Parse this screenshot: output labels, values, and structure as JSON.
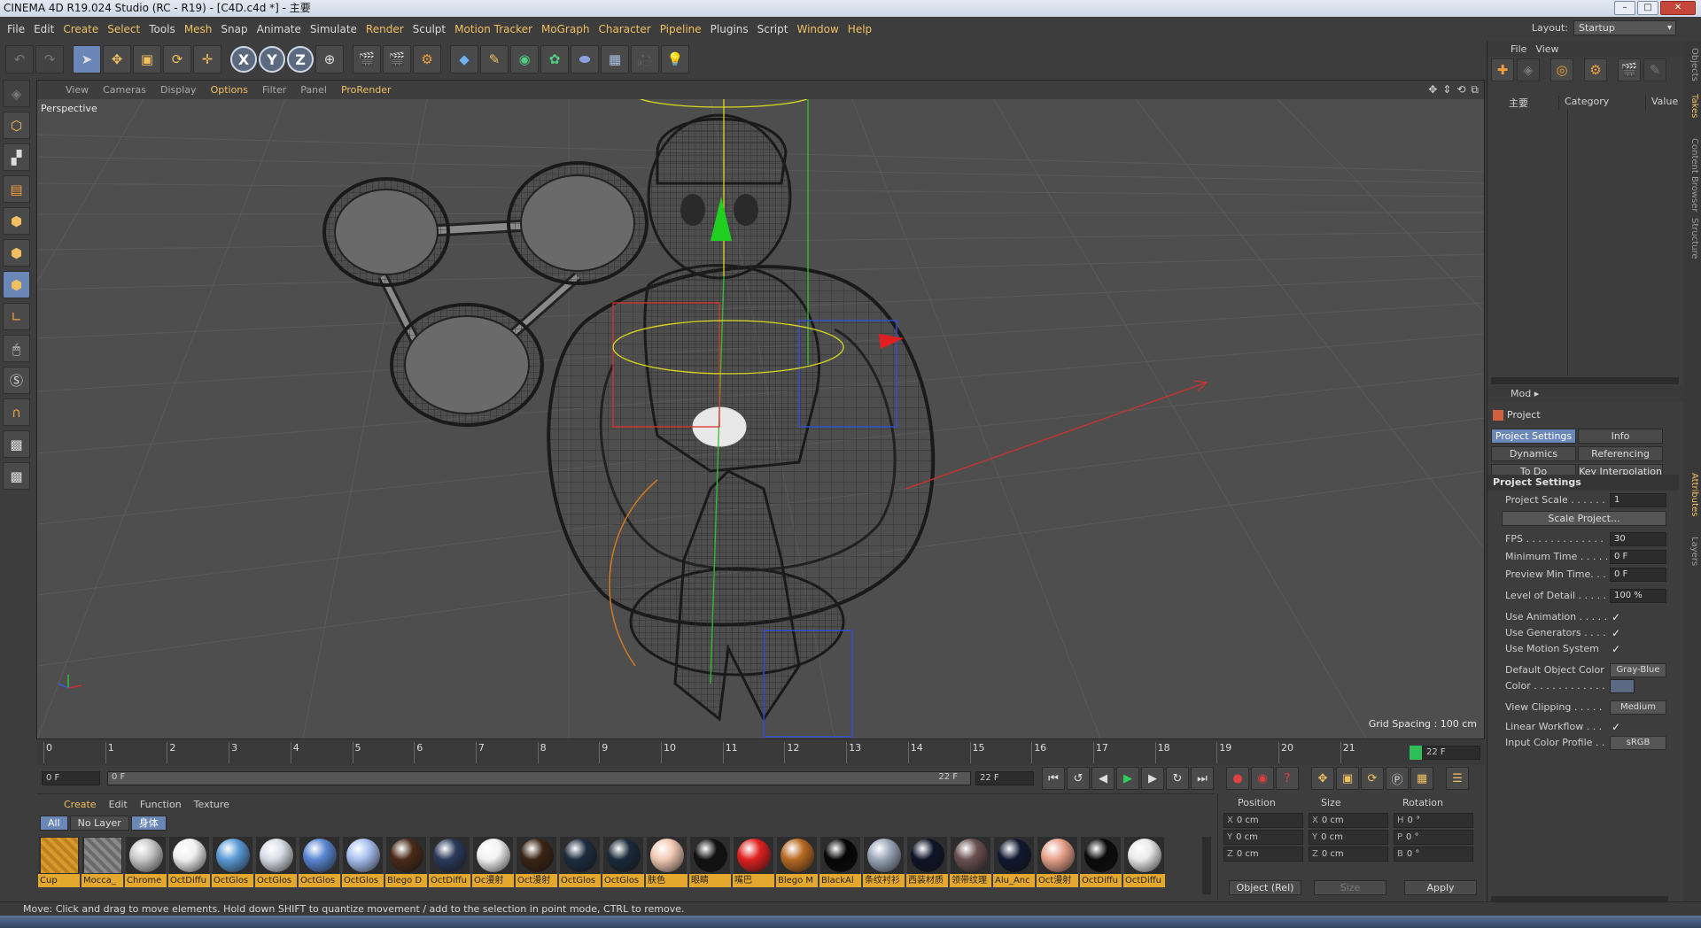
{
  "window": {
    "title": "CINEMA 4D R19.024 Studio (RC - R19) - [C4D.c4d *] - 主要"
  },
  "menu": [
    "File",
    "Edit",
    "Create",
    "Select",
    "Tools",
    "Mesh",
    "Snap",
    "Animate",
    "Simulate",
    "Render",
    "Sculpt",
    "Motion Tracker",
    "MoGraph",
    "Character",
    "Pipeline",
    "Plugins",
    "Script",
    "Window",
    "Help"
  ],
  "layout": {
    "label": "Layout:",
    "value": "Startup"
  },
  "viewport": {
    "menu": [
      "View",
      "Cameras",
      "Display",
      "Options",
      "Filter",
      "Panel",
      "ProRender"
    ],
    "camera": "Perspective",
    "grid_spacing": "Grid Spacing : 100 cm"
  },
  "timeline": {
    "ticks": [
      "0",
      "1",
      "2",
      "3",
      "4",
      "5",
      "6",
      "7",
      "8",
      "9",
      "10",
      "11",
      "12",
      "13",
      "14",
      "15",
      "16",
      "17",
      "18",
      "19",
      "20",
      "21"
    ],
    "current": "22 F",
    "start": "0 F",
    "range_start": "0 F",
    "range_end": "22 F",
    "end": "22 F"
  },
  "materials": {
    "menu": [
      "Create",
      "Edit",
      "Function",
      "Texture"
    ],
    "filters": [
      "All",
      "No Layer",
      "身体"
    ],
    "items": [
      {
        "name": "Cup",
        "color": "#e5a82e"
      },
      {
        "name": "Mocca_",
        "color": "#8a8a8a"
      },
      {
        "name": "Chrome",
        "color": "#c8c8c8"
      },
      {
        "name": "OctDiffu",
        "color": "#f0f0f0"
      },
      {
        "name": "OctGlos",
        "color": "#5b9ad6"
      },
      {
        "name": "OctGlos",
        "color": "#d8dde6"
      },
      {
        "name": "OctGlos",
        "color": "#5a86d2"
      },
      {
        "name": "OctGlos",
        "color": "#a8c0f0"
      },
      {
        "name": "Blego D",
        "color": "#4a2a18"
      },
      {
        "name": "OctDiffu",
        "color": "#2a3a5a"
      },
      {
        "name": "Oc漫射",
        "color": "#f2f2f2"
      },
      {
        "name": "Oct漫射",
        "color": "#3a2414"
      },
      {
        "name": "OctGlos",
        "color": "#1c2c3e"
      },
      {
        "name": "OctGlos",
        "color": "#1a2a3a"
      },
      {
        "name": "肤色",
        "color": "#f2c8b4"
      },
      {
        "name": "眼睛",
        "color": "#111111"
      },
      {
        "name": "嘴巴",
        "color": "#e02020"
      },
      {
        "name": "Blego M",
        "color": "#b86a22"
      },
      {
        "name": "BlackAl",
        "color": "#050505"
      },
      {
        "name": "条纹衬衫",
        "color": "#9aa6b8"
      },
      {
        "name": "西装材质",
        "color": "#0e1428"
      },
      {
        "name": "领带纹理",
        "color": "#6a5050"
      },
      {
        "name": "Alu_Anc",
        "color": "#101830"
      },
      {
        "name": "Oct漫射",
        "color": "#e8a08a"
      },
      {
        "name": "OctDiffu",
        "color": "#0a0a0a"
      },
      {
        "name": "OctDiffu",
        "color": "#eaeaea"
      }
    ]
  },
  "coords": {
    "headers": [
      "Position",
      "Size",
      "Rotation"
    ],
    "rows": [
      {
        "a": "X",
        "p": "0 cm",
        "b": "X",
        "s": "0 cm",
        "c": "H",
        "r": "0 °"
      },
      {
        "a": "Y",
        "p": "0 cm",
        "b": "Y",
        "s": "0 cm",
        "c": "P",
        "r": "0 °"
      },
      {
        "a": "Z",
        "p": "0 cm",
        "b": "Z",
        "s": "0 cm",
        "c": "B",
        "r": "0 °"
      }
    ],
    "mode": "Object (Rel)",
    "size_mode": "Size",
    "apply": "Apply"
  },
  "objects": {
    "menu": [
      "File",
      "View"
    ],
    "item": "主要",
    "cols": [
      "Category",
      "Value"
    ]
  },
  "attributes": {
    "mode": "Mod",
    "object": "Project",
    "tabs": [
      "Project Settings",
      "Info",
      "Dynamics",
      "Referencing",
      "To Do",
      "Key Interpolation"
    ],
    "section": "Project Settings",
    "fields": [
      {
        "label": "Project Scale . . . . . .",
        "value": "1"
      },
      {
        "label": "",
        "value": "Scale Project..."
      },
      {
        "label": "FPS . . . . . . . . . . . . .",
        "value": "30"
      },
      {
        "label": "Minimum Time . . . . .",
        "value": "0 F"
      },
      {
        "label": "Preview Min Time. . .",
        "value": "0 F"
      },
      {
        "label": "Level of Detail . . . . .",
        "value": "100 %"
      },
      {
        "label": "Use Animation . . . . .",
        "value": "✓"
      },
      {
        "label": "Use Generators . . . .",
        "value": "✓"
      },
      {
        "label": "Use Motion System",
        "value": "✓"
      },
      {
        "label": "Default Object Color",
        "value": "Gray-Blue"
      },
      {
        "label": "Color . . . . . . . . . . . .",
        "value": ""
      },
      {
        "label": "View Clipping . . . . .",
        "value": "Medium"
      },
      {
        "label": "Linear Workflow . . .",
        "value": "✓"
      },
      {
        "label": "Input Color Profile . .",
        "value": "sRGB"
      }
    ]
  },
  "side_tabs": [
    "Objects",
    "Takes",
    "Content Browser",
    "Structure",
    "Attributes",
    "Layers"
  ],
  "status": "Move: Click and drag to move elements. Hold down SHIFT to quantize movement / add to the selection in point mode, CTRL to remove.",
  "colors": {
    "accent": "#6a87b8",
    "highlight": "#f0c060",
    "material_label": "#e5a82e"
  }
}
